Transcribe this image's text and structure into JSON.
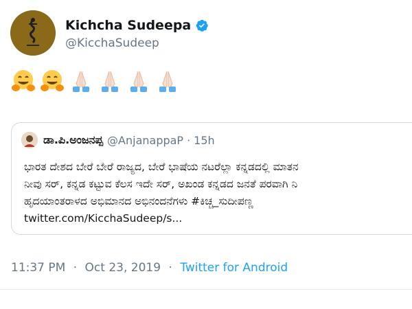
{
  "author": {
    "display_name": "Kichcha Sudeepa",
    "handle": "@KicchaSudeep",
    "verified": true
  },
  "tweet": {
    "emojis": [
      "hugging-face",
      "hugging-face",
      "folded-hands",
      "folded-hands",
      "folded-hands",
      "folded-hands"
    ]
  },
  "quoted_tweet": {
    "author_name": "ಡಾ.ಪಿ.ಅಂಜನಪ್ಪ",
    "handle": "@AnjanappaP",
    "separator": "·",
    "time": "15h",
    "lines": [
      "ಭಾರತ ದೇಶದ ಬೇರೆ ಬೇರೆ ರಾಜ್ಯದ, ಬೇರೆ ಭಾಷೆಯ ನಟರೆಲ್ಲಾ ಕನ್ನಡದಲ್ಲಿ ಮಾತನ",
      "ನೀವು ಸರ್, ಕನ್ನಡ ಕಟ್ಟುವ ಕೆಲಸ ಇದೇ ಸರ್, ಅಖಂಡ ಕನ್ನಡದ ಜನತೆ ಪರವಾಗಿ ನಿ",
      "ಹೃದಯಾಂತರಾಳದ ಅಭಿಮಾನದ ಅಭಿನಂದನೆಗಳು #ಕಿಚ್ಚ_ಸುದೀಪಣ್ಣ",
      "twitter.com/KicchaSudeep/s..."
    ]
  },
  "meta": {
    "time": "11:37 PM",
    "separator": "·",
    "date": "Oct 23, 2019",
    "client": "Twitter for Android"
  },
  "colors": {
    "link_blue": "#1da1f2",
    "secondary_gray": "#657786",
    "border": "#cfd9de"
  }
}
